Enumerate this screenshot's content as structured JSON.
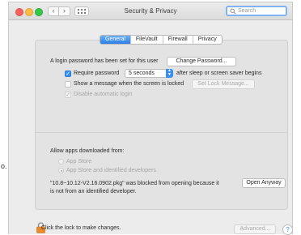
{
  "window": {
    "title": "Security & Privacy",
    "search_placeholder": "Search"
  },
  "tabs": [
    {
      "label": "General",
      "active": true
    },
    {
      "label": "FileVault",
      "active": false
    },
    {
      "label": "Firewall",
      "active": false
    },
    {
      "label": "Privacy",
      "active": false
    }
  ],
  "general": {
    "password_text": "A login password has been set for this user",
    "change_password_label": "Change Password...",
    "require_password_label": "Require password",
    "require_password_value": "5 seconds",
    "after_sleep_text": "after sleep or screen saver begins",
    "show_message_label": "Show a message when the screen is locked",
    "set_lock_message_label": "Set Lock Message...",
    "disable_login_label": "Disable automatic login"
  },
  "downloads": {
    "heading": "Allow apps downloaded from:",
    "option_app_store": "App Store",
    "option_identified": "App Store and identified developers",
    "blocked_line1": "\"10.8~10.12-V2.16.0902.pkg\" was blocked from opening because it",
    "blocked_line2": "is not from an identified developer.",
    "open_anyway_label": "Open Anyway"
  },
  "footer": {
    "lock_text": "Click the lock to make changes.",
    "advanced_label": "Advanced...",
    "help_label": "?"
  },
  "outside_text": "o.",
  "colors": {
    "accent": "#3a8ff0",
    "lock_orange": "#e98b2a"
  },
  "icons": [
    "close-icon",
    "minimize-icon",
    "zoom-icon",
    "back-icon",
    "forward-icon",
    "grid-icon",
    "search-icon",
    "checkmark-icon",
    "lock-icon",
    "help-icon"
  ]
}
